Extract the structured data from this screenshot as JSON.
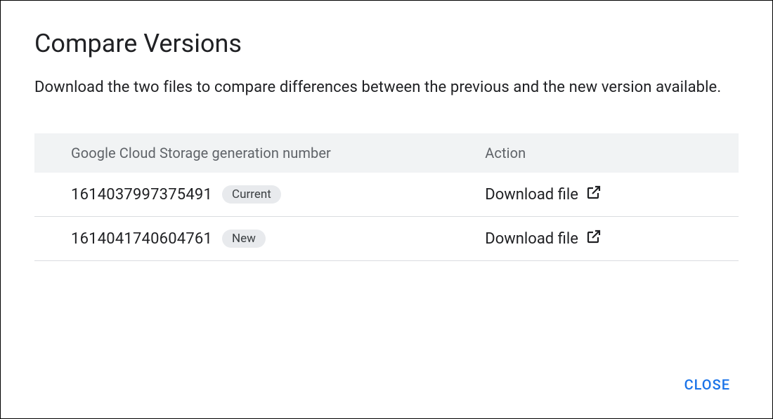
{
  "dialog": {
    "title": "Compare Versions",
    "description": "Download the two files to compare differences between the previous and the new version available.",
    "close_label": "CLOSE"
  },
  "table": {
    "headers": {
      "generation": "Google Cloud Storage generation number",
      "action": "Action"
    },
    "rows": [
      {
        "generation": "1614037997375491",
        "badge": "Current",
        "action_label": "Download file"
      },
      {
        "generation": "1614041740604761",
        "badge": "New",
        "action_label": "Download file"
      }
    ]
  }
}
